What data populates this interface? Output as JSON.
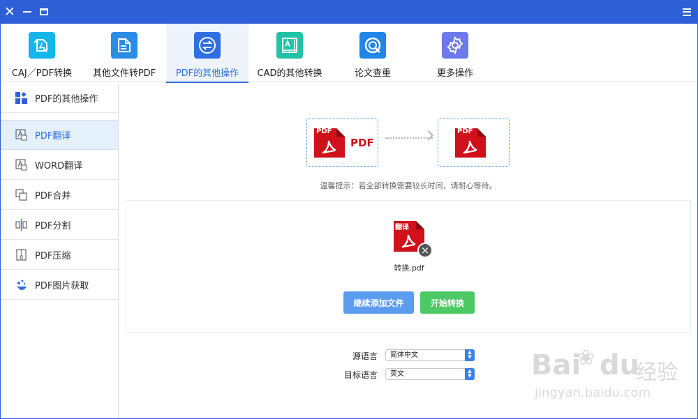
{
  "titlebar": {
    "close_icon": "close-icon",
    "minimize_icon": "minimize-icon",
    "maximize_icon": "maximize-icon",
    "menu_icon": "menu-icon",
    "color": "#2f5fd6"
  },
  "toolbar": {
    "tools": [
      {
        "label": "CAJ／PDF转换",
        "icon": "caj-pdf-convert-icon",
        "color": "#13b5ea"
      },
      {
        "label": "其他文件转PDF",
        "icon": "file-to-pdf-icon",
        "color": "#2b8ce6"
      },
      {
        "label": "PDF的其他操作",
        "icon": "pdf-operations-icon",
        "color": "#2f6fe0",
        "active": true
      },
      {
        "label": "CAD的其他转换",
        "icon": "cad-convert-icon",
        "color": "#21c2a6"
      },
      {
        "label": "论文查重",
        "icon": "paper-check-icon",
        "color": "#1f86e8"
      },
      {
        "label": "更多操作",
        "icon": "more-operations-icon",
        "color": "#6c79e8"
      }
    ]
  },
  "sidebar": {
    "items": [
      {
        "label": "PDF的其他操作",
        "icon": "grid-icon"
      },
      {
        "label": "PDF翻译",
        "icon": "translate-icon",
        "selected": true
      },
      {
        "label": "WORD翻译",
        "icon": "translate-icon"
      },
      {
        "label": "PDF合并",
        "icon": "merge-icon"
      },
      {
        "label": "PDF分割",
        "icon": "split-icon"
      },
      {
        "label": "PDF压缩",
        "icon": "compress-icon"
      },
      {
        "label": "PDF图片获取",
        "icon": "image-extract-icon"
      }
    ]
  },
  "main": {
    "flow": {
      "source_badge": "PDF",
      "source_label": "PDF",
      "target_badge": "PDF"
    },
    "tip": "温馨提示：若全部转换需要较长时间，请耐心等待。",
    "file": {
      "badge": "翻译",
      "name": "转换.pdf",
      "remove_symbol": "×"
    },
    "buttons": {
      "add": "继续添加文件",
      "start": "开始转换"
    },
    "language": {
      "source_label": "源语言",
      "source_value": "简体中文",
      "target_label": "目标语言",
      "target_value": "英文"
    }
  },
  "watermark": {
    "brand": "Bai",
    "brand2": "du",
    "cn": "经验",
    "url": "jingyan.baidu.com"
  },
  "colors": {
    "accent": "#2f6fe0",
    "pdf_red": "#d0101b",
    "add_button": "#5b9cf0",
    "start_button": "#4cc865"
  }
}
